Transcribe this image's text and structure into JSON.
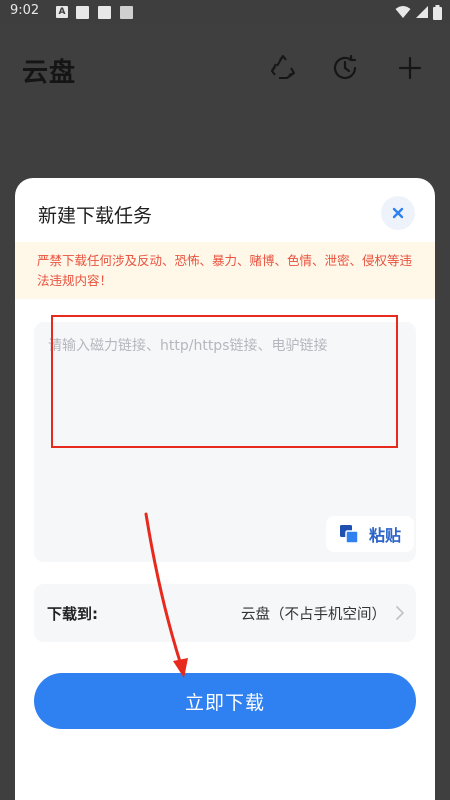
{
  "status_bar": {
    "time": "9:02",
    "badge_letter": "A"
  },
  "header": {
    "title": "云盘",
    "icons": [
      "recycle-icon",
      "history-icon",
      "add-icon"
    ]
  },
  "sheet": {
    "title": "新建下载任务",
    "warning": "严禁下载任何涉及反动、恐怖、暴力、赌博、色情、泄密、侵权等违法违规内容！",
    "input": {
      "value": "",
      "placeholder": "请输入磁力链接、http/https链接、电驴链接"
    },
    "paste_label": "粘贴",
    "destination": {
      "label": "下载到:",
      "value": "云盘（不占手机空间）"
    },
    "download_label": "立即下载"
  },
  "colors": {
    "accent": "#2f80f0",
    "warning_text": "#e8533f",
    "warning_bg": "#fff7e8",
    "annotation": "#e8291d"
  }
}
